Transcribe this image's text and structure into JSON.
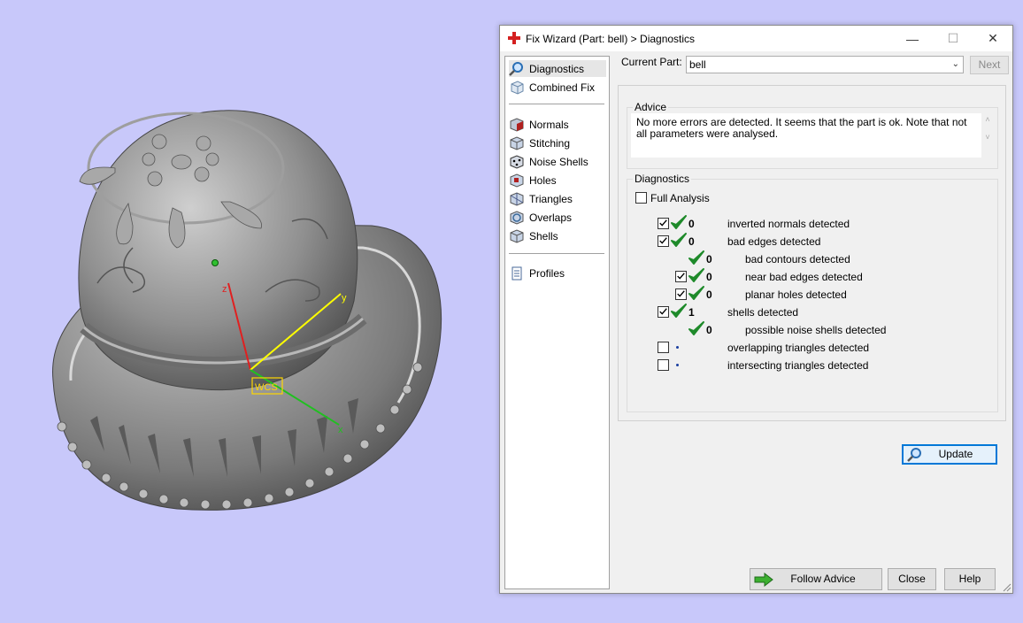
{
  "viewport": {
    "axis_labels": {
      "z": "z",
      "y": "y",
      "x": "x"
    },
    "wcs_label": "WCS",
    "colors": {
      "background": "#c8c8fa",
      "model": "#8c8c8c",
      "z_axis": "#e02020",
      "y_axis": "#ffff00",
      "x_axis": "#20c020"
    }
  },
  "window": {
    "title": "Fix Wizard (Part: bell) > Diagnostics",
    "title_icon": "red-cross-icon",
    "buttons": {
      "minimize": "—",
      "maximize": "☐",
      "close": "✕"
    }
  },
  "nav": {
    "items": [
      {
        "label": "Diagnostics",
        "icon": "magnifier-icon",
        "selected": true
      },
      {
        "label": "Combined Fix",
        "icon": "cube-icon"
      },
      {
        "label": "Normals",
        "icon": "normals-icon"
      },
      {
        "label": "Stitching",
        "icon": "stitching-icon"
      },
      {
        "label": "Noise Shells",
        "icon": "noise-shells-icon"
      },
      {
        "label": "Holes",
        "icon": "holes-icon"
      },
      {
        "label": "Triangles",
        "icon": "triangles-icon"
      },
      {
        "label": "Overlaps",
        "icon": "overlaps-icon"
      },
      {
        "label": "Shells",
        "icon": "shells-icon"
      },
      {
        "label": "Profiles",
        "icon": "profiles-icon"
      }
    ]
  },
  "current_part": {
    "label": "Current Part:",
    "value": "bell",
    "next_label": "Next"
  },
  "advice": {
    "title": "Advice",
    "text": "No more errors are detected. It seems that the part is ok. Note that not all parameters were analysed."
  },
  "diagnostics": {
    "title": "Diagnostics",
    "full_analysis_label": "Full Analysis",
    "full_analysis_checked": false,
    "rows": [
      {
        "checked": true,
        "status": "ok",
        "count": "0",
        "label": "inverted normals detected"
      },
      {
        "checked": true,
        "status": "ok",
        "count": "0",
        "label": "bad edges detected"
      },
      {
        "checked": null,
        "status": "ok",
        "count": "0",
        "label": "bad contours detected"
      },
      {
        "checked": true,
        "status": "ok",
        "count": "0",
        "label": "near bad edges detected"
      },
      {
        "checked": true,
        "status": "ok",
        "count": "0",
        "label": "planar holes detected"
      },
      {
        "checked": true,
        "status": "ok",
        "count": "1",
        "label": "shells detected"
      },
      {
        "checked": null,
        "status": "ok",
        "count": "0",
        "label": "possible noise shells detected"
      },
      {
        "checked": false,
        "status": "not-run",
        "count": "",
        "label": "overlapping triangles detected"
      },
      {
        "checked": false,
        "status": "not-run",
        "count": "",
        "label": "intersecting triangles detected"
      }
    ],
    "update_label": "Update"
  },
  "footer": {
    "follow_advice_label": "Follow Advice",
    "close_label": "Close",
    "help_label": "Help"
  },
  "colors": {
    "accent": "#0078d7",
    "check_green": "#1e8a2a",
    "arrow_green": "#3cb030"
  }
}
